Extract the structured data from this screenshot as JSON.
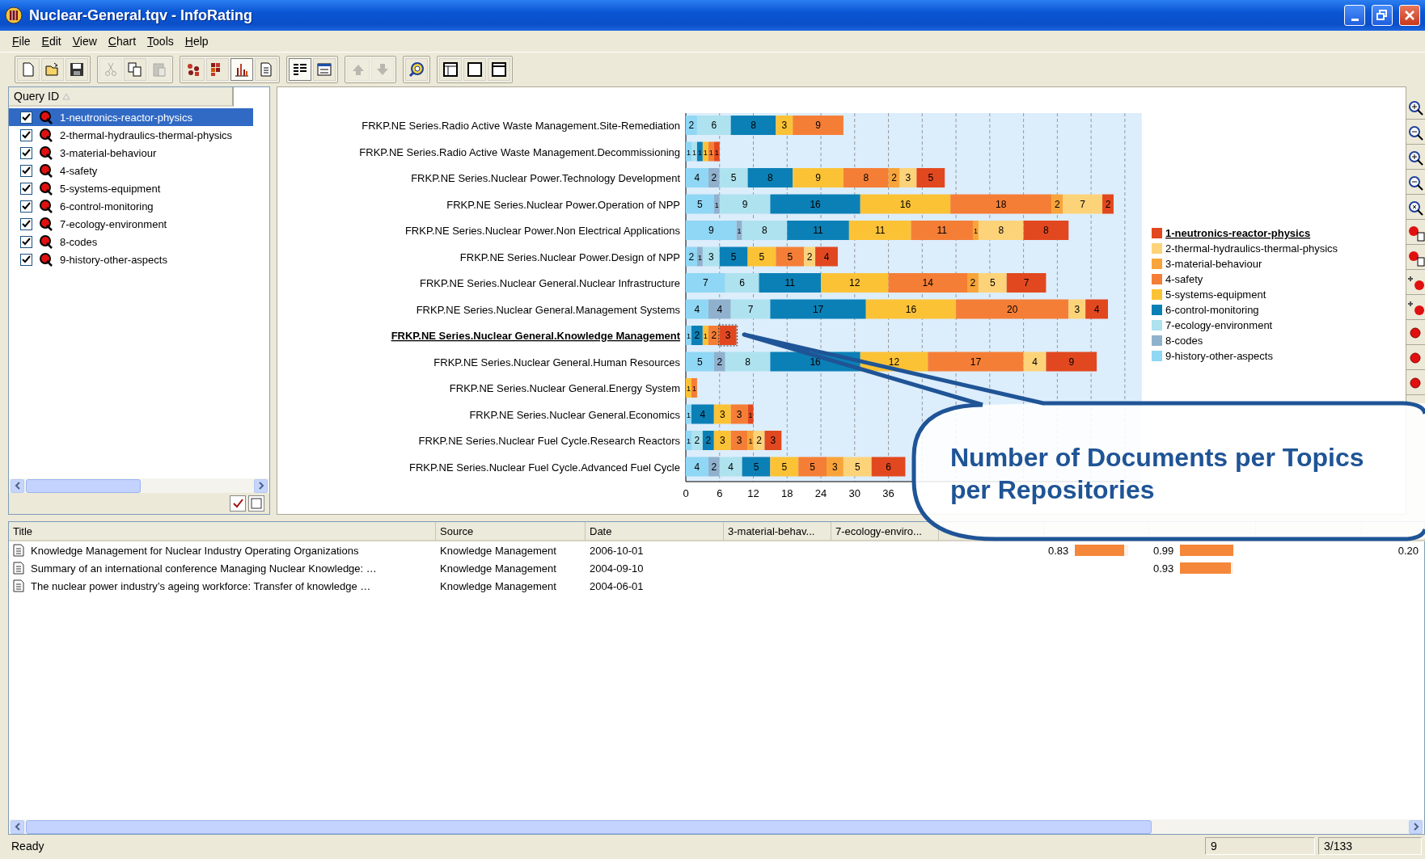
{
  "window": {
    "title": "Nuclear-General.tqv - InfoRating"
  },
  "menu": [
    "File",
    "Edit",
    "View",
    "Chart",
    "Tools",
    "Help"
  ],
  "toolbar": [
    [
      {
        "kind": "new",
        "disabled": false,
        "pressed": false
      },
      {
        "kind": "open",
        "disabled": false,
        "pressed": false
      },
      {
        "kind": "save",
        "disabled": false,
        "pressed": false
      }
    ],
    [
      {
        "kind": "cut",
        "disabled": true,
        "pressed": false
      },
      {
        "kind": "copy",
        "disabled": false,
        "pressed": false
      },
      {
        "kind": "paste",
        "disabled": true,
        "pressed": false
      }
    ],
    [
      {
        "kind": "scatter",
        "disabled": false,
        "pressed": false
      },
      {
        "kind": "matrix",
        "disabled": false,
        "pressed": false
      },
      {
        "kind": "bars",
        "disabled": false,
        "pressed": true
      },
      {
        "kind": "report",
        "disabled": false,
        "pressed": false
      }
    ],
    [
      {
        "kind": "list",
        "disabled": false,
        "pressed": true
      },
      {
        "kind": "details",
        "disabled": false,
        "pressed": false
      }
    ],
    [
      {
        "kind": "up",
        "disabled": true,
        "pressed": false
      },
      {
        "kind": "down",
        "disabled": true,
        "pressed": false
      }
    ],
    [
      {
        "kind": "target",
        "disabled": false,
        "pressed": false
      }
    ],
    [
      {
        "kind": "layout-left",
        "disabled": false,
        "pressed": false
      },
      {
        "kind": "layout-single",
        "disabled": false,
        "pressed": false
      },
      {
        "kind": "layout-top",
        "disabled": false,
        "pressed": false
      }
    ]
  ],
  "query_list": {
    "header": "Query ID",
    "items": [
      {
        "label": "1-neutronics-reactor-physics",
        "checked": true,
        "selected": true
      },
      {
        "label": "2-thermal-hydraulics-thermal-physics",
        "checked": true,
        "selected": false
      },
      {
        "label": "3-material-behaviour",
        "checked": true,
        "selected": false
      },
      {
        "label": "4-safety",
        "checked": true,
        "selected": false
      },
      {
        "label": "5-systems-equipment",
        "checked": true,
        "selected": false
      },
      {
        "label": "6-control-monitoring",
        "checked": true,
        "selected": false
      },
      {
        "label": "7-ecology-environment",
        "checked": true,
        "selected": false
      },
      {
        "label": "8-codes",
        "checked": true,
        "selected": false
      },
      {
        "label": "9-history-other-aspects",
        "checked": true,
        "selected": false
      }
    ]
  },
  "chart": {
    "chart_data": {
      "type": "bar",
      "orientation": "horizontal",
      "stacked": true,
      "data_labels": true,
      "grid": true,
      "legend": true,
      "xlim": [
        0,
        81
      ],
      "xticks": [
        0,
        6,
        12,
        18,
        24,
        30,
        36
      ],
      "categories": [
        "FRKP.NE Series.Radio Active Waste Management.Site-Remediation",
        "FRKP.NE Series.Radio Active Waste Management.Decommissioning",
        "FRKP.NE Series.Nuclear Power.Technology Development",
        "FRKP.NE Series.Nuclear Power.Operation of NPP",
        "FRKP.NE Series.Nuclear Power.Non Electrical Applications",
        "FRKP.NE Series.Nuclear Power.Design of NPP",
        "FRKP.NE Series.Nuclear General.Nuclear Infrastructure",
        "FRKP.NE Series.Nuclear General.Management Systems",
        "FRKP.NE Series.Nuclear General.Knowledge Management",
        "FRKP.NE Series.Nuclear General.Human Resources",
        "FRKP.NE Series.Nuclear General.Energy System",
        "FRKP.NE Series.Nuclear General.Economics",
        "FRKP.NE Series.Nuclear Fuel Cycle.Research Reactors",
        "FRKP.NE Series.Nuclear Fuel Cycle.Advanced Fuel Cycle"
      ],
      "series": [
        {
          "name": "1-neutronics-reactor-physics",
          "color": "#e2481f",
          "values": [
            null,
            1,
            5,
            2,
            8,
            4,
            7,
            4,
            3,
            9,
            null,
            1,
            3,
            6
          ]
        },
        {
          "name": "2-thermal-hydraulics-thermal-physics",
          "color": "#fdd37a",
          "values": [
            null,
            null,
            3,
            7,
            8,
            2,
            5,
            3,
            null,
            4,
            null,
            null,
            2,
            5
          ]
        },
        {
          "name": "3-material-behaviour",
          "color": "#f8a43a",
          "values": [
            null,
            null,
            2,
            2,
            1,
            null,
            2,
            null,
            null,
            null,
            null,
            null,
            1,
            3
          ]
        },
        {
          "name": "4-safety",
          "color": "#f57e36",
          "values": [
            9,
            1,
            8,
            18,
            11,
            5,
            14,
            20,
            2,
            17,
            1,
            3,
            3,
            5
          ]
        },
        {
          "name": "5-systems-equipment",
          "color": "#fcc236",
          "values": [
            3,
            1,
            9,
            16,
            11,
            5,
            12,
            16,
            1,
            12,
            1,
            3,
            3,
            5
          ]
        },
        {
          "name": "6-control-monitoring",
          "color": "#0b80b6",
          "values": [
            8,
            1,
            8,
            16,
            11,
            5,
            11,
            17,
            2,
            16,
            null,
            4,
            2,
            5
          ]
        },
        {
          "name": "7-ecology-environment",
          "color": "#aee2ef",
          "values": [
            6,
            1,
            5,
            9,
            8,
            3,
            6,
            7,
            null,
            8,
            null,
            null,
            2,
            4
          ]
        },
        {
          "name": "8-codes",
          "color": "#90b1cd",
          "values": [
            null,
            null,
            2,
            1,
            1,
            1,
            null,
            4,
            null,
            2,
            null,
            null,
            null,
            2
          ]
        },
        {
          "name": "9-history-other-aspects",
          "color": "#8fd7f4",
          "values": [
            2,
            1,
            4,
            5,
            9,
            2,
            7,
            4,
            1,
            5,
            null,
            1,
            1,
            4
          ]
        }
      ]
    },
    "category_selected": [
      false,
      false,
      false,
      false,
      false,
      false,
      false,
      false,
      true,
      false,
      false,
      false,
      false,
      false
    ],
    "series_selected": [
      true,
      false,
      false,
      false,
      false,
      false,
      false,
      false,
      false
    ]
  },
  "callout": {
    "text": "Number of Documents per Topics per Repositories"
  },
  "results_table": {
    "columns": [
      "Title",
      "Source",
      "Date",
      "3-material-behav...",
      "7-ecology-enviro..."
    ],
    "rows": [
      {
        "title": "Knowledge Management for Nuclear Industry Operating Organizations",
        "source": "Knowledge Management",
        "date": "2006-10-01",
        "column_7": {
          "value": "0.83",
          "level": 0.92
        },
        "column_8": {
          "value": "0.99",
          "level": 1
        },
        "column_10": {
          "value": "0.20"
        }
      },
      {
        "title": "Summary of an international conference Managing Nuclear Knowledge: …",
        "source": "Knowledge Management",
        "date": "2004-09-10",
        "column_8": {
          "value": "0.93",
          "level": 0.95
        }
      },
      {
        "title": "The nuclear power industry’s ageing workforce: Transfer of knowledge …",
        "source": "Knowledge Management",
        "date": "2004-06-01"
      }
    ]
  },
  "status_bar": {
    "text": "Ready",
    "panes": [
      "9",
      "3/133"
    ]
  }
}
